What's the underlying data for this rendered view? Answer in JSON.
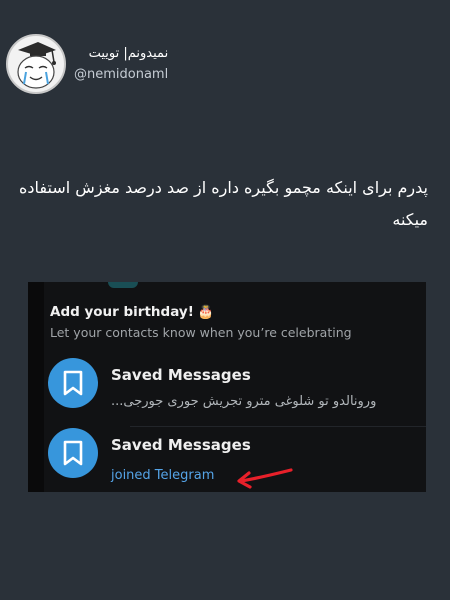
{
  "header": {
    "user_name": "نمیدونم| توییت",
    "handle": "@nemidonaml"
  },
  "tweet": {
    "text": "پدرم برای اینکه مچمو بگیره داره از صد درصد مغزش استفاده میکنه"
  },
  "screenshot": {
    "birthday": {
      "title": "Add your birthday!",
      "cake": "🎂",
      "subtitle": "Let your contacts know when you’re celebrating"
    },
    "chats": [
      {
        "title": "Saved Messages",
        "preview": "ورونالدو تو شلوغی مترو تجریش جوری جورجی..."
      },
      {
        "title": "Saved Messages",
        "preview": "joined Telegram"
      }
    ],
    "colors": {
      "accent": "#3796dc",
      "link": "#55a4e8",
      "arrow": "#e8202a"
    }
  }
}
